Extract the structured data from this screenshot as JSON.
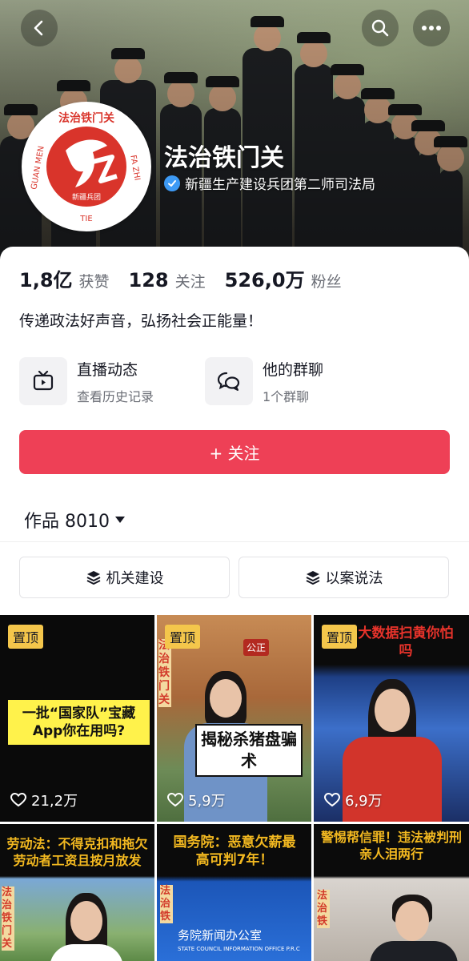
{
  "header": {
    "nickname": "法治铁门关",
    "verified_text": "新疆生产建设兵团第二师司法局",
    "avatar": {
      "ring_text_top": "法治铁门关",
      "ring_text_right": "FA ZHI",
      "ring_text_left": "GUAN MEN",
      "ring_text_bottom": "TIE",
      "emblem_text": "新疆兵团"
    }
  },
  "stats": [
    {
      "value": "1,8亿",
      "label": "获赞"
    },
    {
      "value": "128",
      "label": "关注"
    },
    {
      "value": "526,0万",
      "label": "粉丝"
    }
  ],
  "bio": "传递政法好声音，弘扬社会正能量！",
  "features": [
    {
      "title": "直播动态",
      "subtitle": "查看历史记录",
      "icon": "tv-icon"
    },
    {
      "title": "他的群聊",
      "subtitle": "1个群聊",
      "icon": "chat-bubbles-icon"
    }
  ],
  "follow_button": "+ 关注",
  "works": {
    "label": "作品 8010"
  },
  "collections": [
    {
      "label": "机关建设",
      "icon": "stack-icon"
    },
    {
      "label": "以案说法",
      "icon": "stack-icon"
    }
  ],
  "videos": [
    {
      "pinned": "置顶",
      "likes": "21,2万",
      "caption": "一批“国家队”宝藏App你在用吗?"
    },
    {
      "pinned": "置顶",
      "likes": "5,9万",
      "caption": "揭秘杀猪盘骗 术",
      "sign": "公正",
      "banner": "法治铁门关"
    },
    {
      "pinned": "置顶",
      "likes": "6,9万",
      "caption": "大数据扫黄你怕吗"
    },
    {
      "caption": "劳动法：不得克扣和拖欠劳动者工资且按月放发",
      "banner": "法治铁门关"
    },
    {
      "caption": "国务院：恶意欠薪最高可判7年！",
      "sub": "务院新闻办公室",
      "sub2": "STATE COUNCIL INFORMATION OFFICE P.R.C",
      "banner": "法治铁"
    },
    {
      "caption": "警惕帮信罪！违法被判刑 亲人泪两行",
      "banner": "法治铁"
    }
  ],
  "colors": {
    "accent": "#ee4056",
    "pin": "#f4c64b",
    "verified": "#3d9af5"
  }
}
